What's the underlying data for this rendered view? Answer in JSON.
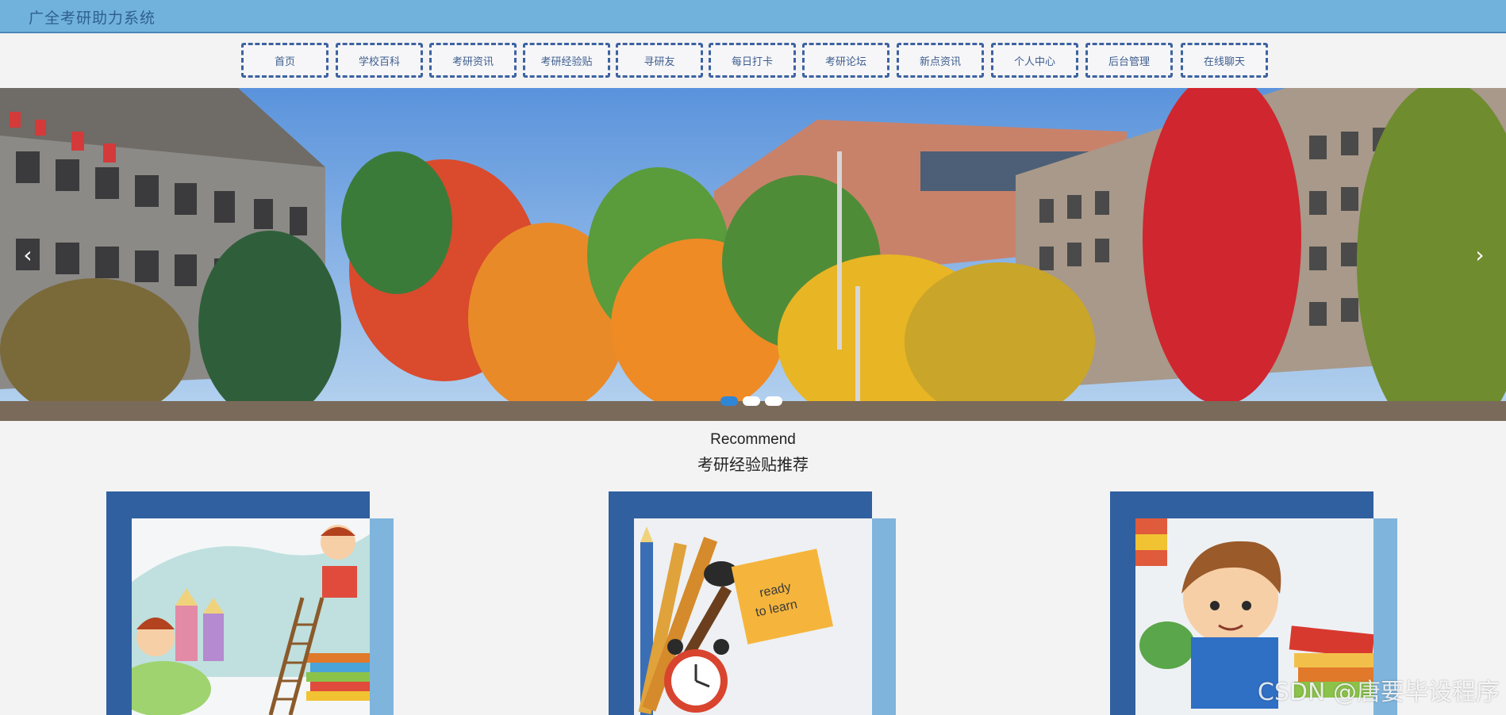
{
  "header": {
    "site_title": "广全考研助力系统"
  },
  "nav": {
    "items": [
      "首页",
      "学校百科",
      "考研资讯",
      "考研经验贴",
      "寻研友",
      "每日打卡",
      "考研论坛",
      "新点资讯",
      "个人中心",
      "后台管理",
      "在线聊天"
    ]
  },
  "banner": {
    "prev_icon": "chevron-left-icon",
    "next_icon": "chevron-right-icon",
    "prev_glyph": "‹",
    "next_glyph": "›",
    "slide_count": 3,
    "active_slide": 1
  },
  "recommend": {
    "title_en": "Recommend",
    "title_cn": "考研经验贴推荐",
    "cards": [
      {
        "image": "children-reading-illustration"
      },
      {
        "image": "pencils-clock-note-illustration",
        "note_text_1": "ready",
        "note_text_2": "to learn"
      },
      {
        "image": "boy-with-books-illustration"
      }
    ]
  },
  "watermark": "CSDN @唐要毕设程序",
  "colors": {
    "topbar": "#71b2dc",
    "nav_border": "#3d62a1",
    "card_frame": "#3060a0",
    "card_side": "#7fb4dc",
    "dot_active": "#2f86d6"
  }
}
